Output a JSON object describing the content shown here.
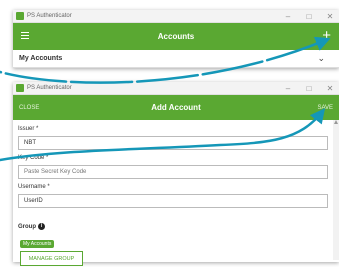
{
  "window1": {
    "app_title": "PS Authenticator",
    "header_title": "Accounts",
    "add_glyph": "+",
    "menu_icon": "hamburger-icon",
    "section_label": "My Accounts",
    "chevron_glyph": "⌄"
  },
  "window2": {
    "app_title": "PS Authenticator",
    "close_label": "CLOSE",
    "header_title": "Add Account",
    "save_label": "SAVE",
    "issuer_label": "Issuer *",
    "issuer_value": "NBT",
    "keycode_label": "Key Code *",
    "keycode_placeholder": "Paste Secret Key Code",
    "username_label": "Username *",
    "username_value": "UserID",
    "group_label": "Group",
    "group_info_glyph": "i",
    "group_chip": "My Accounts",
    "manage_group_label": "MANAGE GROUP"
  },
  "window_controls": {
    "minimize": "–",
    "maximize": "□",
    "close": "✕"
  },
  "colors": {
    "accent": "#5aa832",
    "arrow": "#1597b8"
  }
}
